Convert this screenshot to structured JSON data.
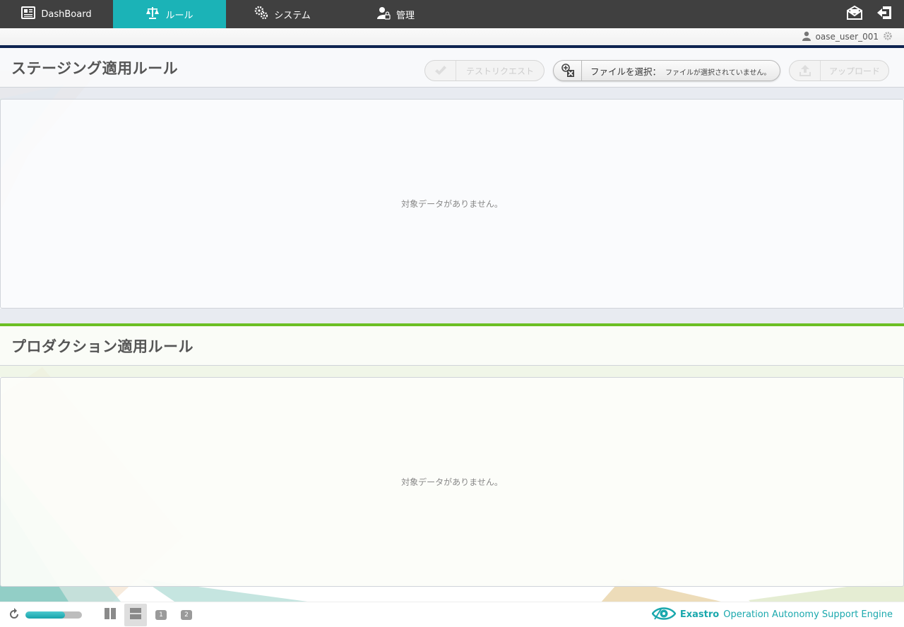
{
  "nav": {
    "items": [
      {
        "label": "DashBoard",
        "icon": "dashboard-icon",
        "active": false
      },
      {
        "label": "ルール",
        "icon": "scale-icon",
        "active": true
      },
      {
        "label": "システム",
        "icon": "gears-icon",
        "active": false
      },
      {
        "label": "管理",
        "icon": "user-lock-icon",
        "active": false
      }
    ],
    "right_icons": [
      "mail-icon",
      "logout-icon"
    ]
  },
  "user": {
    "name": "oase_user_001"
  },
  "staging": {
    "title": "ステージング適用ルール",
    "test_request_label": "テストリクエスト",
    "file_select_label": "ファイルを選択：",
    "file_none_label": "ファイルが選択されていません。",
    "upload_label": "アップロード",
    "empty_message": "対象データがありません。"
  },
  "production": {
    "title": "プロダクション適用ルール",
    "empty_message": "対象データがありません。"
  },
  "footer": {
    "progress": 0.7,
    "page_buttons": [
      "1",
      "2"
    ],
    "brand_strong": "Exastro",
    "brand_rest": "Operation Autonomy Support Engine"
  },
  "colors": {
    "nav_bg": "#404040",
    "nav_active": "#1bb3b7",
    "staging_accent": "#0e2450",
    "production_accent": "#6cbf24",
    "brand": "#1aa8ad"
  }
}
